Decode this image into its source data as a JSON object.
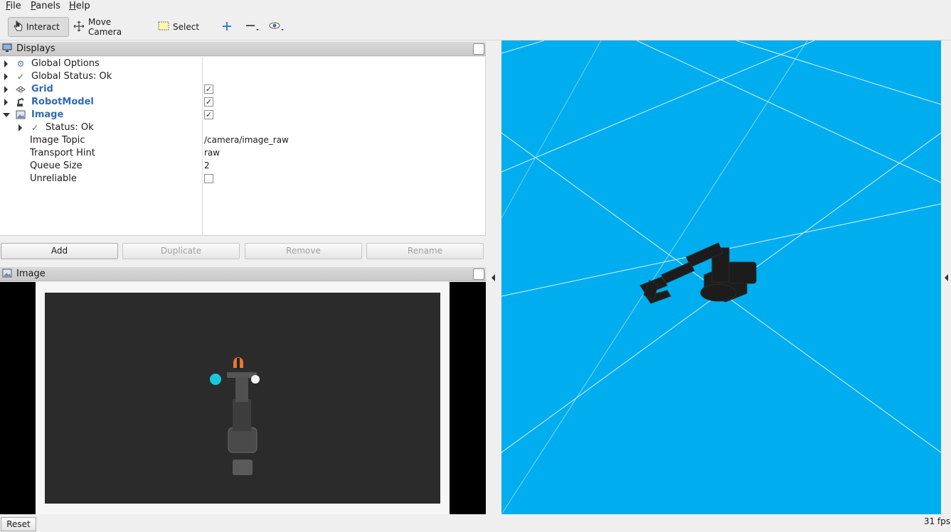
{
  "menu": [
    "File",
    "Panels",
    "Help"
  ],
  "toolbar": {
    "interact": "Interact",
    "move_camera": "Move Camera",
    "select": "Select"
  },
  "displays_panel": {
    "title": "Displays",
    "rows": [
      {
        "label": "Global Options",
        "icon": "gear-icon"
      },
      {
        "label": "Global Status: Ok",
        "icon": "check-icon"
      },
      {
        "label": "Grid",
        "icon": "grid-icon",
        "checked": true
      },
      {
        "label": "RobotModel",
        "icon": "robot-icon",
        "checked": true
      },
      {
        "label": "Image",
        "icon": "image-icon",
        "checked": true
      },
      {
        "label": "Status: Ok",
        "icon": "check-icon"
      },
      {
        "label": "Image Topic",
        "value": "/camera/image_raw"
      },
      {
        "label": "Transport Hint",
        "value": "raw"
      },
      {
        "label": "Queue Size",
        "value": "2"
      },
      {
        "label": "Unreliable",
        "checked": false
      }
    ]
  },
  "buttons": {
    "add": "Add",
    "duplicate": "Duplicate",
    "remove": "Remove",
    "rename": "Rename"
  },
  "image_panel": {
    "title": "Image"
  },
  "status": {
    "reset": "Reset",
    "fps": "31 fps"
  },
  "colors": {
    "view_background": "#00adef",
    "image_background": "#2b2b2b",
    "accent_label": "#2f6bb5"
  }
}
